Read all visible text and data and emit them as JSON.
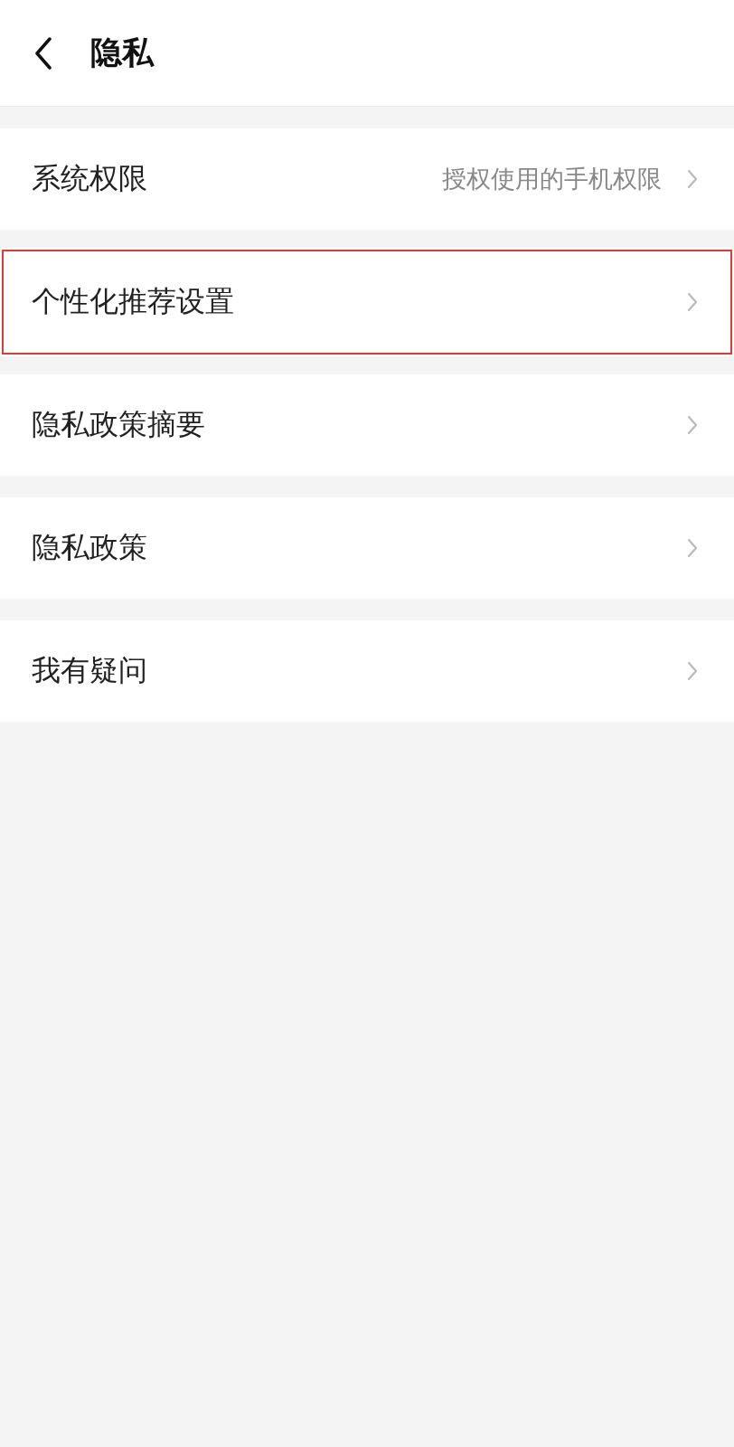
{
  "header": {
    "title": "隐私"
  },
  "items": [
    {
      "label": "系统权限",
      "value": "授权使用的手机权限",
      "highlighted": false
    },
    {
      "label": "个性化推荐设置",
      "highlighted": true
    },
    {
      "label": "隐私政策摘要",
      "highlighted": false
    },
    {
      "label": "隐私政策",
      "highlighted": false
    },
    {
      "label": "我有疑问",
      "highlighted": false
    }
  ]
}
